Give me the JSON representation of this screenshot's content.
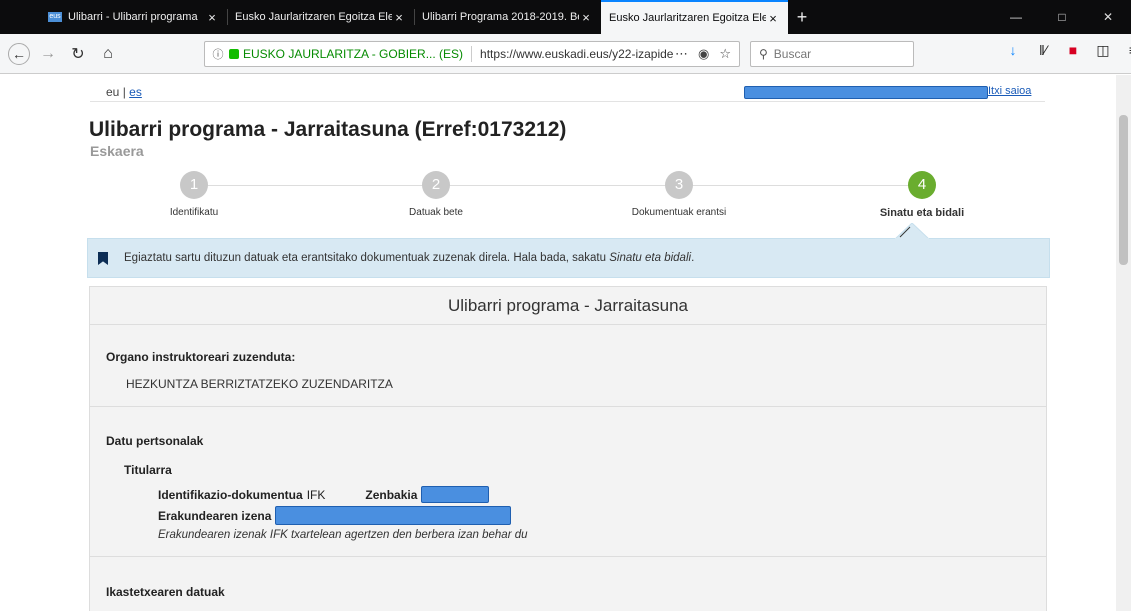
{
  "browser": {
    "tabs": [
      {
        "title": "Ulibarri - Ulibarri programa",
        "close": "×",
        "active": false
      },
      {
        "title": "Eusko Jaurlaritzaren Egoitza Elektro",
        "close": "×",
        "active": false
      },
      {
        "title": "Ulibarri Programa 2018-2019. Berriz",
        "close": "×",
        "active": false
      },
      {
        "title": "Eusko Jaurlaritzaren Egoitza Elektro",
        "close": "×",
        "active": true
      }
    ],
    "new_tab": "+",
    "url_identity": "EUSKO JAURLARITZA - GOBIER... (ES)",
    "url": "https://www.euskadi.eus/y22-izapide",
    "search_placeholder": "Buscar"
  },
  "page": {
    "lang": {
      "eu": "eu",
      "sep": "|",
      "es": "es"
    },
    "logout": "Itxi saioa",
    "title": "Ulibarri programa - Jarraitasuna (Erref:0173212)",
    "subtitle": "Eskaera",
    "steps": [
      {
        "num": "1",
        "label": "Identifikatu"
      },
      {
        "num": "2",
        "label": "Datuak bete"
      },
      {
        "num": "3",
        "label": "Dokumentuak erantsi"
      },
      {
        "num": "4",
        "label": "Sinatu eta bidali"
      }
    ],
    "active_step": 4,
    "alert": {
      "text": "Egiaztatu sartu dituzun datuak eta erantsitako dokumentuak zuzenak direla. Hala bada, sakatu ",
      "link": "Sinatu eta bidali",
      "end": "."
    },
    "panel": {
      "title": "Ulibarri programa - Jarraitasuna",
      "organo_label": "Organo instruktoreari zuzenduta:",
      "organo_value": "HEZKUNTZA BERRIZTATZEKO ZUZENDARITZA",
      "datu_label": "Datu pertsonalak",
      "titularra_label": "Titularra",
      "doc_label": "Identifikazio-dokumentua",
      "doc_value": "IFK",
      "zenbakia_label": "Zenbakia",
      "erakunde_label": "Erakundearen izena",
      "hint": "Erakundearen izenak IFK txartelean agertzen den berbera izan behar du",
      "ikastetxe_label": "Ikastetxearen datuak"
    }
  },
  "colors": {
    "accent": "#0a84ff",
    "step_active": "#6aad2f",
    "alert_bg": "#d8e9f3",
    "redaction": "#4a8fe0"
  }
}
